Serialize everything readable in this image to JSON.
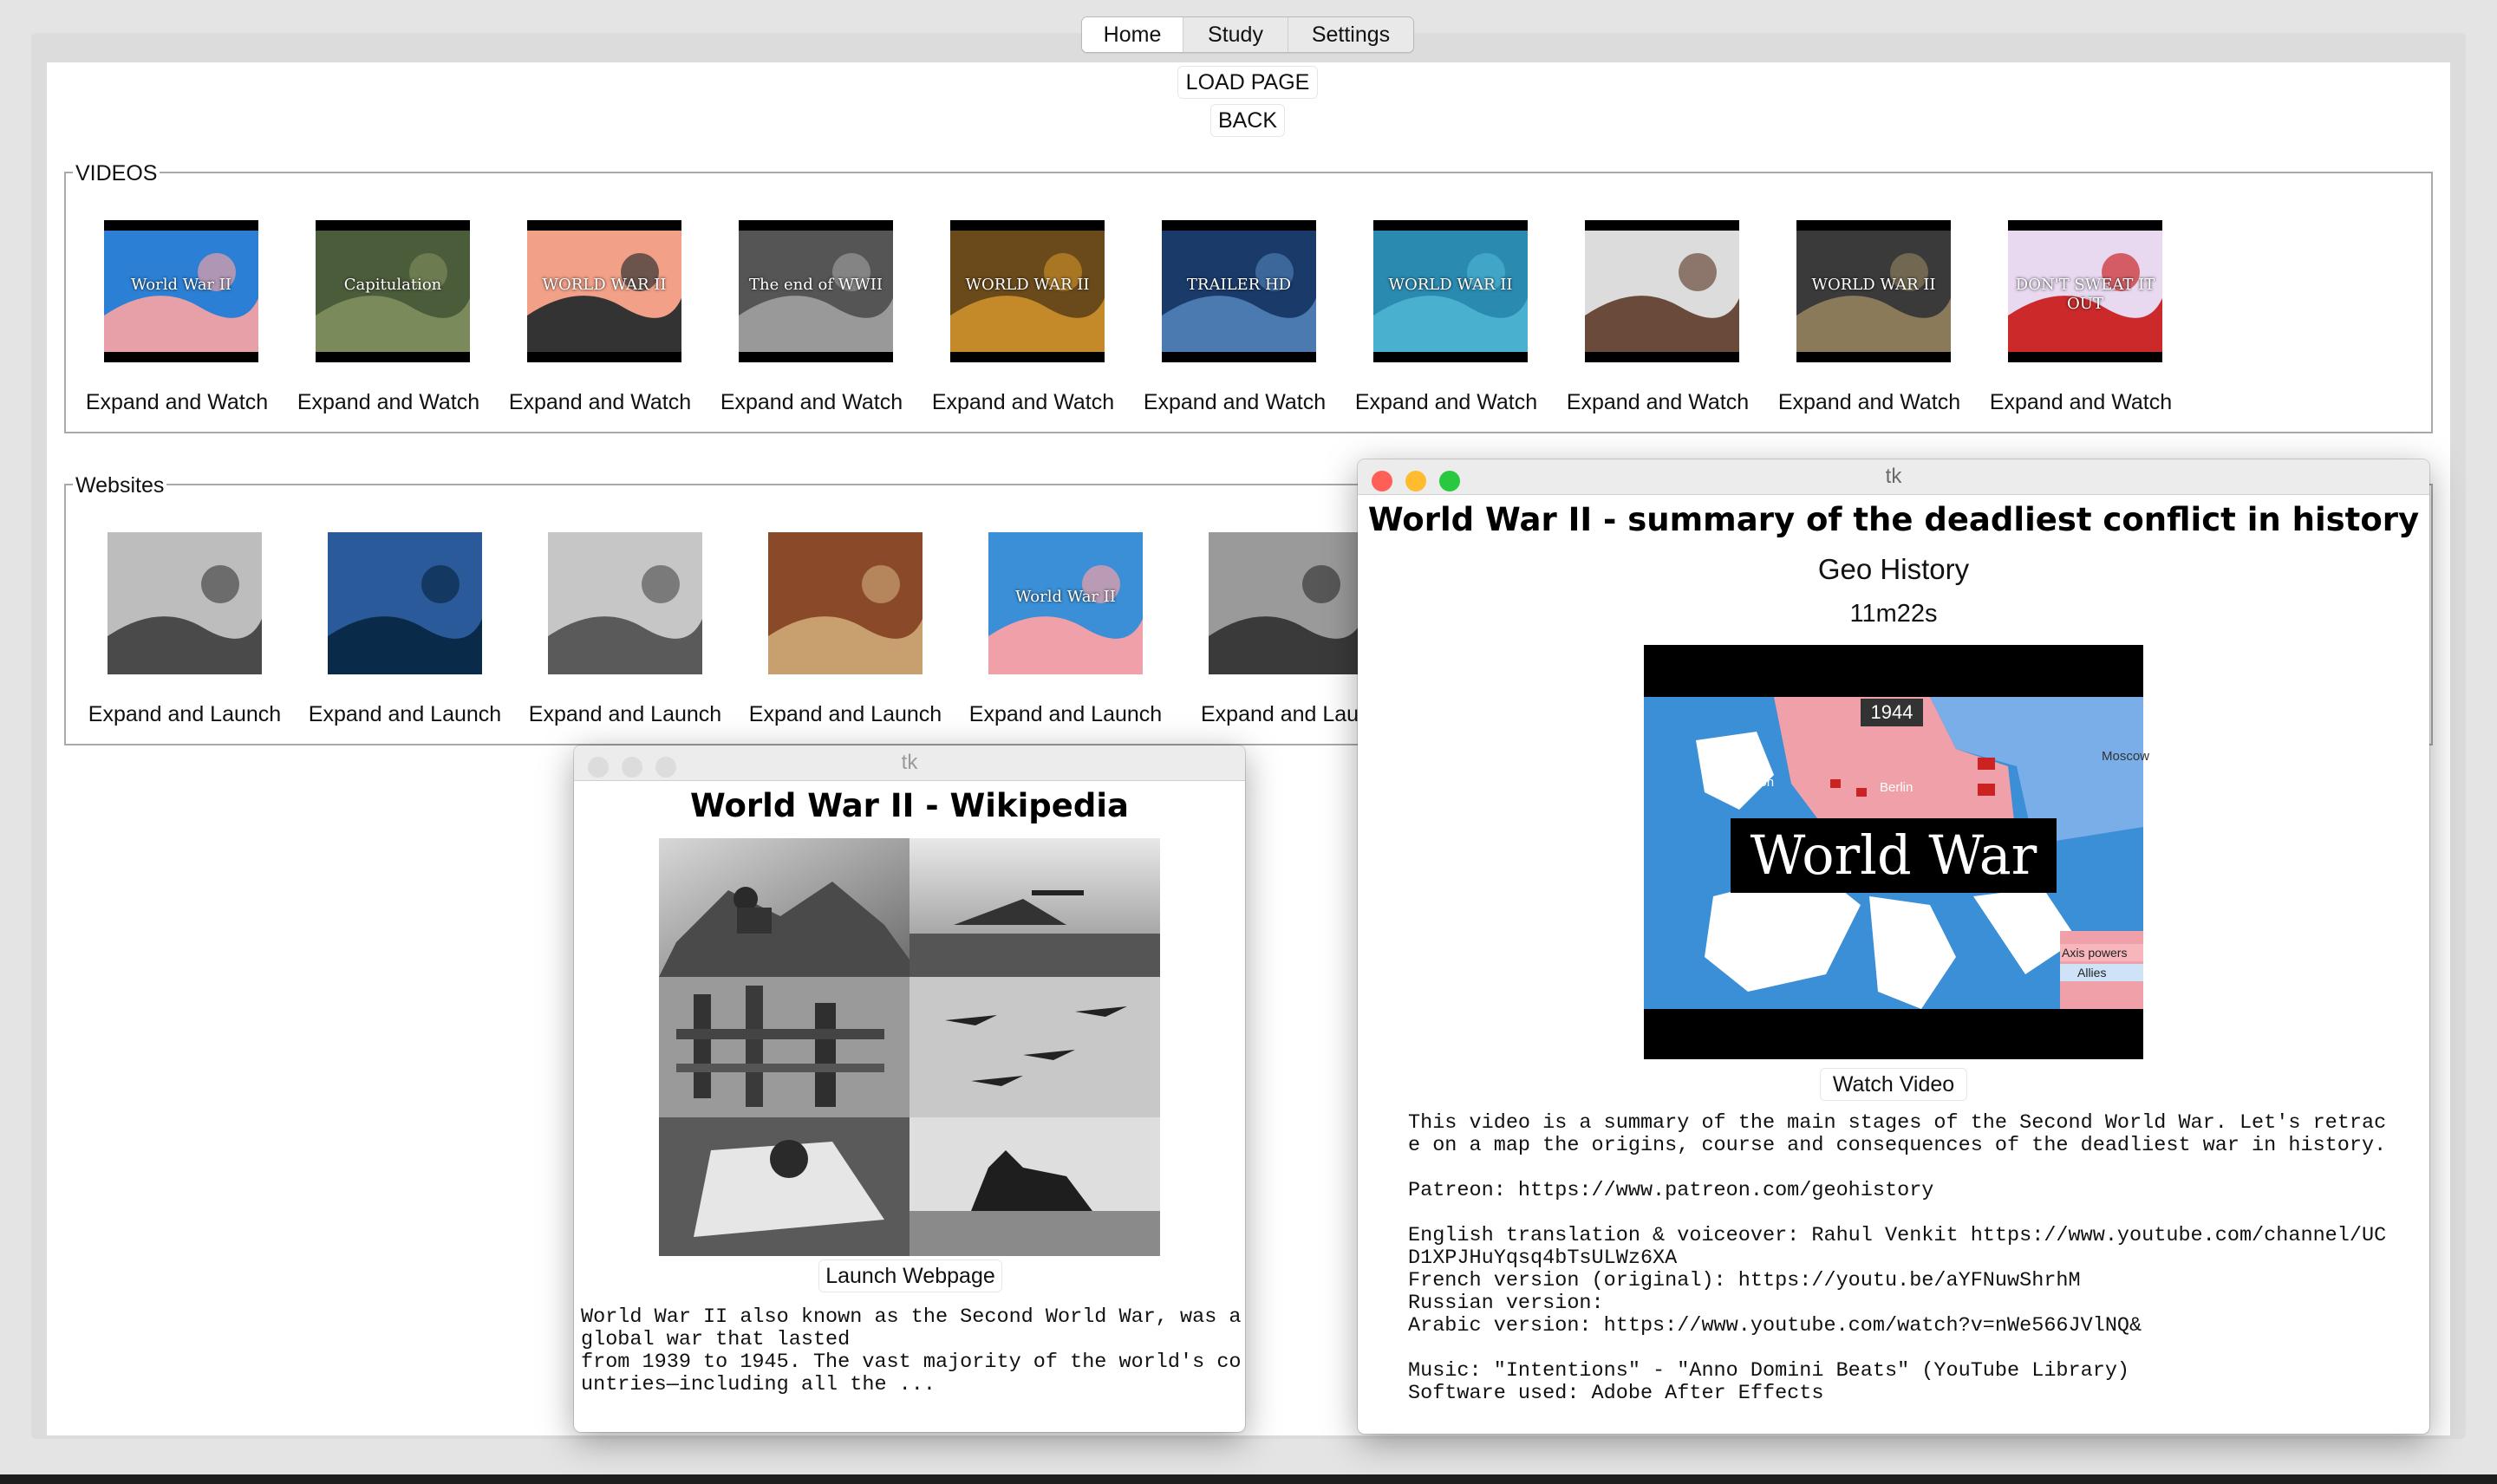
{
  "tabs": [
    {
      "label": "Home",
      "active": true
    },
    {
      "label": "Study",
      "active": false
    },
    {
      "label": "Settings",
      "active": false
    }
  ],
  "toolbar": {
    "load_page": "LOAD PAGE",
    "back": "BACK"
  },
  "videos": {
    "title": "VIDEOS",
    "button_label": "Expand and Watch",
    "thumbnails": [
      {
        "caption": "World War II"
      },
      {
        "caption": "Capitulation"
      },
      {
        "caption": "WORLD WAR II"
      },
      {
        "caption": "The end of WWII"
      },
      {
        "caption": "WORLD WAR II"
      },
      {
        "caption": "TRAILER HD"
      },
      {
        "caption": "WORLD WAR II"
      },
      {
        "caption": ""
      },
      {
        "caption": "WORLD WAR II"
      },
      {
        "caption": "DON'T SWEAT IT OUT"
      }
    ]
  },
  "websites": {
    "title": "Websites",
    "button_label": "Expand and Launch",
    "partial_label": "Expand and Laun",
    "thumbnails": [
      {
        "caption": ""
      },
      {
        "caption": ""
      },
      {
        "caption": ""
      },
      {
        "caption": ""
      },
      {
        "caption": "World War II"
      },
      {
        "caption": ""
      }
    ]
  },
  "wiki_window": {
    "window_title": "tk",
    "heading": "World War II - Wikipedia",
    "launch_button": "Launch Webpage",
    "text_lines": [
      "World War II also known as the Second World War, was a",
      "global war that lasted",
      "from 1939 to 1945. The vast majority of the world's co",
      "untries—including all the ..."
    ]
  },
  "video_window": {
    "window_title": "tk",
    "heading": "World War II - summary of the deadliest conflict in history",
    "channel": "Geo History",
    "duration": "11m22s",
    "watch_button": "Watch Video",
    "video_overlay": {
      "title": "World War II",
      "year": "1944",
      "labels": [
        "London",
        "Berlin",
        "Moscow"
      ],
      "legend": [
        "Axis powers",
        "Allies"
      ]
    },
    "description_lines": [
      "This video is a summary of the main stages of the Second World War. Let's retrac",
      "e on a map the origins, course and consequences of the deadliest war in history.",
      "",
      "Patreon: https://www.patreon.com/geohistory",
      "",
      "English translation & voiceover: Rahul Venkit https://www.youtube.com/channel/UC",
      "D1XPJHuYqsq4bTsULWz6XA",
      "French version (original): https://youtu.be/aYFNuwShrhM",
      "Russian version:",
      "Arabic version: https://www.youtube.com/watch?v=nWe566JVlNQ&",
      "",
      "Music: \"Intentions\" - \"Anno Domini Beats\" (YouTube Library)",
      "Software used: Adobe After Effects"
    ]
  },
  "colors": {
    "close": "#ff5f57",
    "minimize": "#febc2e",
    "zoom": "#28c840",
    "inactive_light": "#dcdcdc",
    "frame_border": "#a9a9a9",
    "map_sea": "#3a8fd6"
  }
}
